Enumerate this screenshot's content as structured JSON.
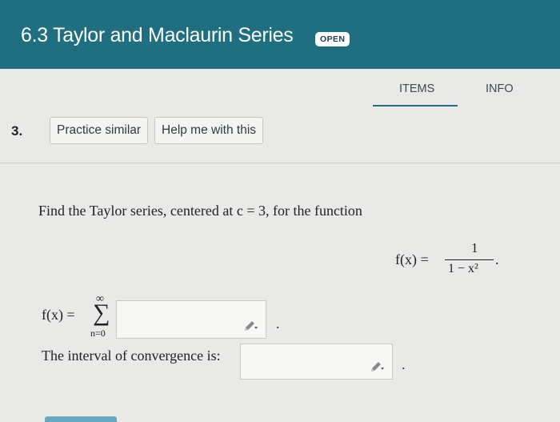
{
  "header": {
    "title": "6.3 Taylor and Maclaurin Series",
    "badge": "OPEN",
    "color": "#1f6f80"
  },
  "tabs": [
    {
      "label": "ITEMS",
      "active": true
    },
    {
      "label": "INFO",
      "active": false
    }
  ],
  "question": {
    "number": "3.",
    "practice_label": "Practice similar",
    "help_label": "Help me with this",
    "prompt": "Find the Taylor series, centered at c = 3, for the function",
    "function": {
      "lhs": "f(x) =",
      "numerator": "1",
      "denominator": "1 − x²",
      "end": "."
    },
    "series": {
      "lhs": "f(x) =",
      "sigma": "∑",
      "upper": "∞",
      "lower": "n=0",
      "end": "."
    },
    "interval_label": "The interval of convergence is:",
    "interval_end": "."
  },
  "icons": {
    "input_edit": "pencil-icon"
  }
}
